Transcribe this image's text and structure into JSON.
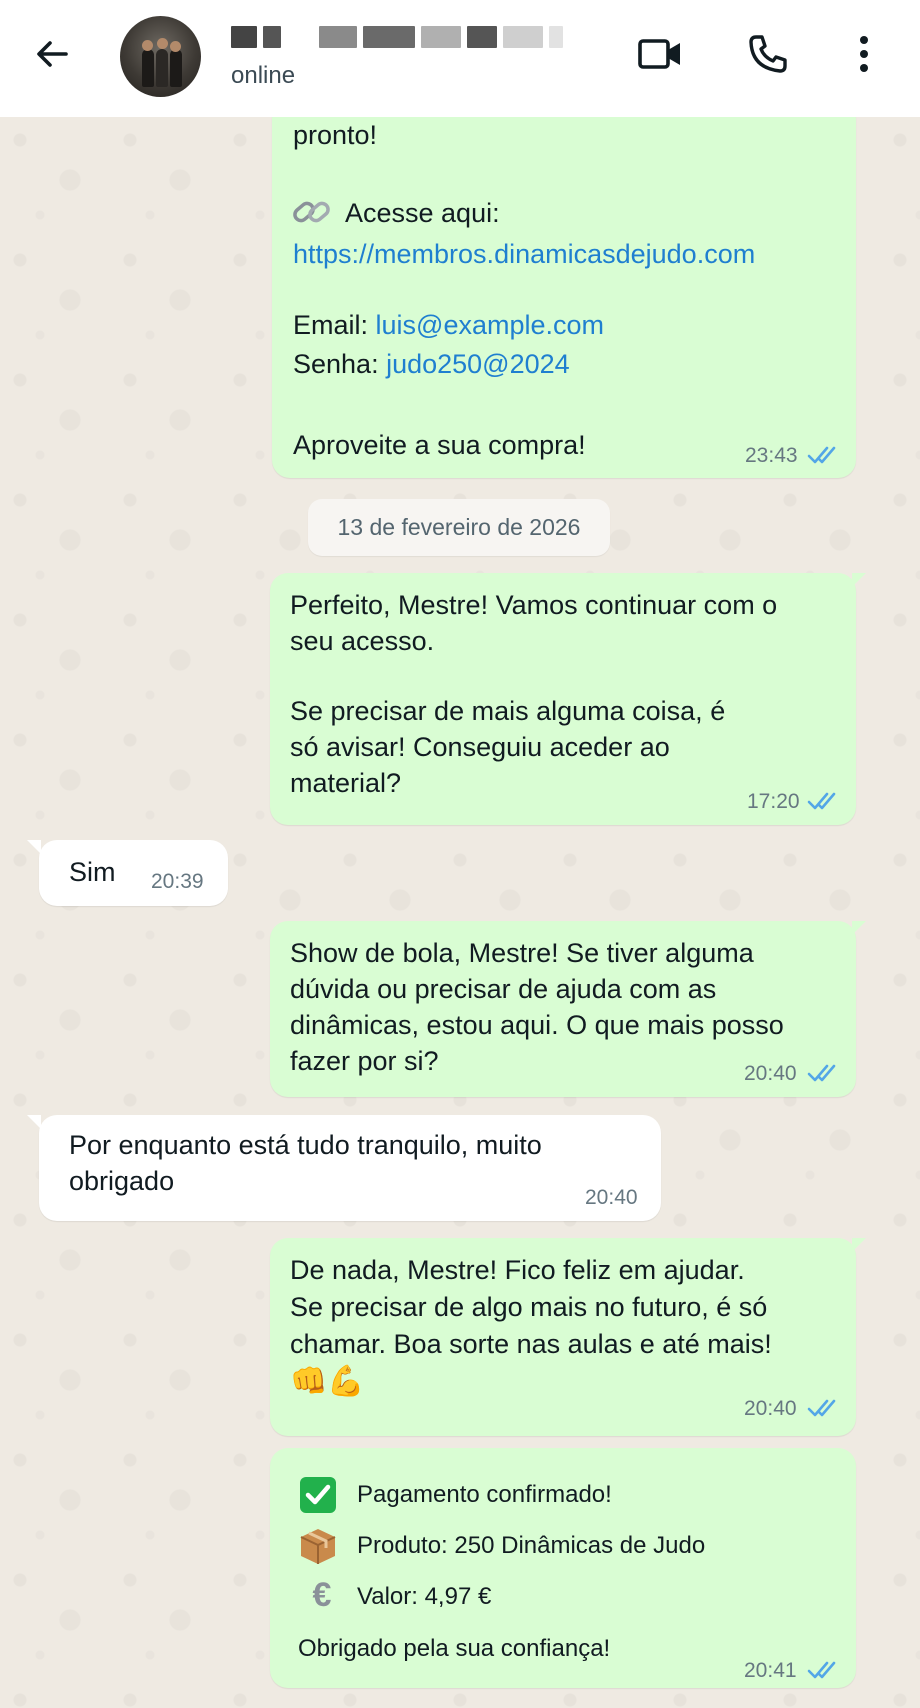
{
  "header": {
    "status": "online",
    "back_icon": "arrow-left-icon",
    "video_icon": "video-camera-icon",
    "call_icon": "phone-icon",
    "menu_icon": "more-vertical-icon"
  },
  "messages": {
    "m1": {
      "line1": "pronto!",
      "access_label": "Acesse aqui:",
      "url": "https://membros.dinamicasdejudo.com",
      "email_label": "Email: ",
      "email_value": "luis@example.com",
      "password_label": "Senha: ",
      "password_value": "judo250@2024",
      "closing": "Aproveite a sua compra!",
      "time": "23:43",
      "icon": "link-icon"
    },
    "date_separator": "13 de fevereiro de 2026",
    "m2": {
      "line1": "Perfeito, Mestre! Vamos continuar com o",
      "line2": "seu acesso.",
      "line3": "Se precisar de mais alguma coisa, é",
      "line4": "só avisar! Conseguiu aceder ao",
      "line5": "material?",
      "time": "17:20"
    },
    "m3": {
      "text": "Sim",
      "time": "20:39"
    },
    "m4": {
      "line1": "Show de bola, Mestre! Se tiver alguma",
      "line2": "dúvida ou precisar de ajuda com as",
      "line3": "dinâmicas, estou aqui. O que mais posso",
      "line4": "fazer por si?",
      "time": "20:40"
    },
    "m5": {
      "line1": "Por enquanto está tudo tranquilo, muito",
      "line2": "obrigado",
      "time": "20:40"
    },
    "m6": {
      "line1": "De nada, Mestre! Fico feliz em ajudar.",
      "line2": "Se precisar de algo mais no futuro, é só",
      "line3": "chamar. Boa sorte nas aulas e até mais!",
      "emojis": "👊💪",
      "time": "20:40"
    },
    "m7": {
      "row1": "Pagamento confirmado!",
      "row2": "Produto: 250 Dinâmicas de Judo",
      "row3": "Valor: 4,97 €",
      "closing": "Obrigado pela sua confiança!",
      "time": "20:41",
      "icons": [
        "check-box-icon",
        "package-icon",
        "euro-icon"
      ]
    }
  },
  "colors": {
    "outgoing_bubble": "#d9fdd3",
    "incoming_bubble": "#ffffff",
    "read_ticks": "#53a6e7",
    "link": "#1f7fd0",
    "background": "#efeae2"
  }
}
